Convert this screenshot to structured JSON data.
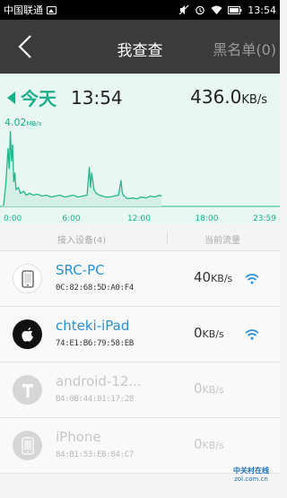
{
  "status_bar": {
    "carrier": "中国联通",
    "time": "13:54"
  },
  "header": {
    "title": "我查查",
    "blacklist_label": "黑名单(0)"
  },
  "summary": {
    "day_label": "今天",
    "time": "13:54",
    "total_speed_value": "436.0",
    "total_speed_unit": "KB/s"
  },
  "chart_data": {
    "type": "line",
    "title": "",
    "peak_label": "4.02",
    "peak_unit": "MB/s",
    "x_ticks": [
      "0:00",
      "6:00",
      "12:00",
      "18:00",
      "23:59"
    ],
    "x_range_hours": [
      0,
      24
    ],
    "y_range_mbps": [
      0,
      4.5
    ],
    "line_color": "#27b58e",
    "series": [
      {
        "x": [
          0,
          0.2,
          0.4,
          0.5,
          0.6,
          0.7,
          0.8,
          0.9,
          1.0,
          1.1,
          1.3,
          1.5,
          1.8,
          2.0,
          2.3,
          2.6,
          3.0,
          3.4,
          3.8,
          4.2,
          4.6,
          5.0,
          5.4,
          5.8,
          6.2,
          6.6,
          7.0,
          7.4,
          7.6,
          7.7,
          7.8,
          8.0,
          8.2,
          8.5,
          8.8,
          9.0,
          9.4,
          9.8,
          10.2,
          10.4,
          10.5,
          10.6,
          10.8,
          11.0,
          11.4,
          11.8,
          12.2,
          12.6,
          13.0,
          13.4,
          13.8,
          14.0
        ],
        "y": [
          0.05,
          1.2,
          3.1,
          2.0,
          4.02,
          2.4,
          3.3,
          1.3,
          1.8,
          0.9,
          1.0,
          0.7,
          0.8,
          0.6,
          0.7,
          0.6,
          0.65,
          0.55,
          0.6,
          0.5,
          0.55,
          0.6,
          0.5,
          0.55,
          0.6,
          0.5,
          0.55,
          0.6,
          2.1,
          1.0,
          1.8,
          0.9,
          0.7,
          0.6,
          0.55,
          0.5,
          0.5,
          0.55,
          0.6,
          1.4,
          0.8,
          0.6,
          0.5,
          0.4,
          0.45,
          0.4,
          0.5,
          0.45,
          0.55,
          0.5,
          0.6,
          0.55
        ]
      }
    ]
  },
  "device_list": {
    "devices_header": "接入设备(4)",
    "traffic_header": "当前流量",
    "devices": [
      {
        "name": "SRC-PC",
        "mac": "0C:82:68:5D:A0:F4",
        "rate_value": "40",
        "rate_unit": "KB/s",
        "online": true,
        "icon": "phone-icon"
      },
      {
        "name": "chteki-iPad",
        "mac": "74:E1:B6:79:58:EB",
        "rate_value": "0",
        "rate_unit": "KB/s",
        "online": true,
        "icon": "apple-icon"
      },
      {
        "name": "android-12...",
        "mac": "B4:0B:44:01:17:28",
        "rate_value": "0",
        "rate_unit": "KB/s",
        "online": false,
        "icon": "hammer-icon"
      },
      {
        "name": "iPhone",
        "mac": "84:B1:53:EB:84:C7",
        "rate_value": "0",
        "rate_unit": "KB/s",
        "online": false,
        "icon": "phone-icon"
      }
    ]
  },
  "watermark": {
    "brand": "中关村在线",
    "site": "zol.com.cn"
  },
  "colors": {
    "accent": "#1bb08a",
    "link": "#2b8ed4",
    "header_bg": "#3b3b3b"
  }
}
